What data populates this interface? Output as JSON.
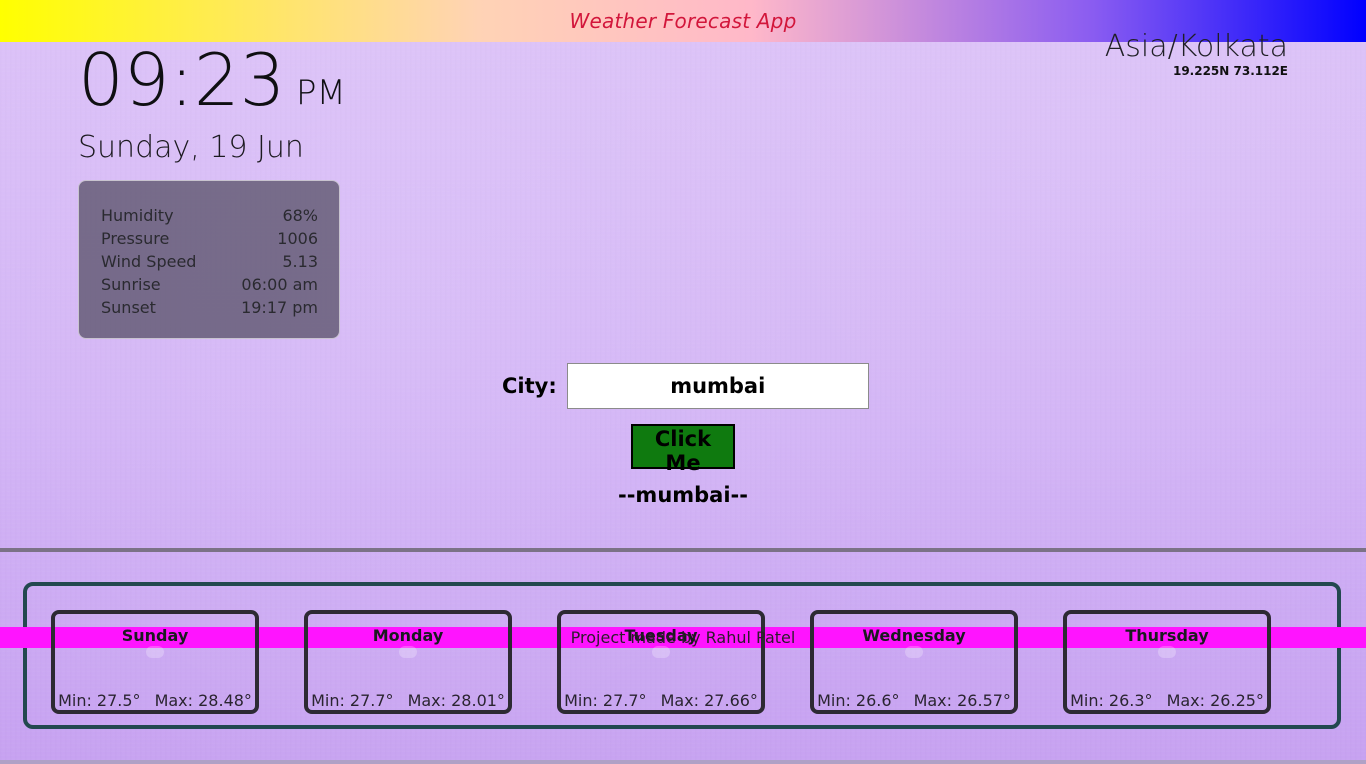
{
  "header": {
    "title": "Weather Forecast App"
  },
  "clock": {
    "time": "09:23",
    "ampm": "PM",
    "date": "Sunday, 19 Jun"
  },
  "timezone": {
    "name": "Asia/Kolkata",
    "coords": "19.225N 73.112E"
  },
  "details": [
    {
      "label": "Humidity",
      "value": "68%"
    },
    {
      "label": "Pressure",
      "value": "1006"
    },
    {
      "label": "Wind Speed",
      "value": "5.13"
    },
    {
      "label": "Sunrise",
      "value": "06:00 am"
    },
    {
      "label": "Sunset",
      "value": "19:17 pm"
    }
  ],
  "search": {
    "label": "City:",
    "value": "mumbai",
    "button_label": "Click Me",
    "result": "--mumbai--"
  },
  "forecast": [
    {
      "day": "Sunday",
      "min": "Min: 27.5°",
      "max": "Max: 28.48°"
    },
    {
      "day": "Monday",
      "min": "Min: 27.7°",
      "max": "Max: 28.01°"
    },
    {
      "day": "Tuesday",
      "min": "Min: 27.7°",
      "max": "Max: 27.66°"
    },
    {
      "day": "Wednesday",
      "min": "Min: 26.6°",
      "max": "Max: 26.57°"
    },
    {
      "day": "Thursday",
      "min": "Min: 26.3°",
      "max": "Max: 26.25°"
    }
  ],
  "footer": {
    "text": "Project made by Rahul Patel"
  },
  "colors": {
    "title_text": "#d2163b",
    "button_bg": "#0f7a0f",
    "footer_strip": "#ff14ff",
    "forecast_border": "#23484f"
  }
}
